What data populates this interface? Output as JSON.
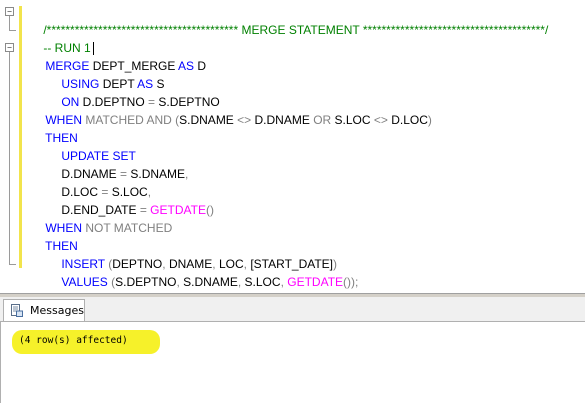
{
  "editor": {
    "lines": {
      "l0": {
        "comment": "/***************************************** MERGE STATEMENT ***************************************/"
      },
      "l1": {
        "comment": "-- RUN 1"
      },
      "l2": {
        "kw1": "MERGE",
        "t1": " DEPT_MERGE ",
        "kw2": "AS",
        "t2": " D"
      },
      "l3": {
        "kw1": "USING",
        "t1": " DEPT ",
        "kw2": "AS",
        "t2": " S"
      },
      "l4": {
        "kw1": "ON",
        "t1": " D.DEPTNO ",
        "op1": "=",
        "t2": " S.DEPTNO"
      },
      "l5": {
        "kw1": "WHEN",
        "g1": " MATCHED AND (",
        "t1": "S.DNAME ",
        "g2": "<>",
        "t2": " D.DNAME ",
        "g3": "OR",
        "t3": " S.LOC ",
        "g4": "<>",
        "t4": " D.LOC",
        "g5": ")"
      },
      "l6": {
        "kw1": "THEN"
      },
      "l7": {
        "kw1": "UPDATE SET"
      },
      "l8": {
        "t1": "D.DNAME ",
        "g1": "=",
        "t2": " S.DNAME",
        "g2": ","
      },
      "l9": {
        "t1": "D.LOC ",
        "g1": "=",
        "t2": " S.LOC",
        "g2": ","
      },
      "l10": {
        "t1": "D.END_DATE ",
        "g1": "=",
        "fn1": " GETDATE",
        "g2": "()"
      },
      "l11": {
        "kw1": "WHEN",
        "g1": " NOT MATCHED"
      },
      "l12": {
        "kw1": "THEN"
      },
      "l13": {
        "kw1": "INSERT",
        "g1": " (",
        "t1": "DEPTNO",
        "g2": ",",
        "t2": " DNAME",
        "g3": ",",
        "t3": " LOC",
        "g4": ",",
        "t4": " [START_DATE]",
        "g5": ")"
      },
      "l14": {
        "kw1": "VALUES",
        "g1": " (",
        "t1": "S.DEPTNO",
        "g2": ",",
        "t2": " S.DNAME",
        "g3": ",",
        "t3": " S.LOC",
        "g4": ",",
        "fn1": " GETDATE",
        "g5": "());"
      }
    }
  },
  "results": {
    "tab_label": "Messages",
    "message": "(4 row(s) affected)"
  },
  "colors": {
    "keyword": "#0000ff",
    "comment": "#008000",
    "operator": "#808080",
    "function": "#ff00ff",
    "highlight": "#f6f12a"
  },
  "icons": {
    "messages_tab": "messages-document-icon"
  }
}
